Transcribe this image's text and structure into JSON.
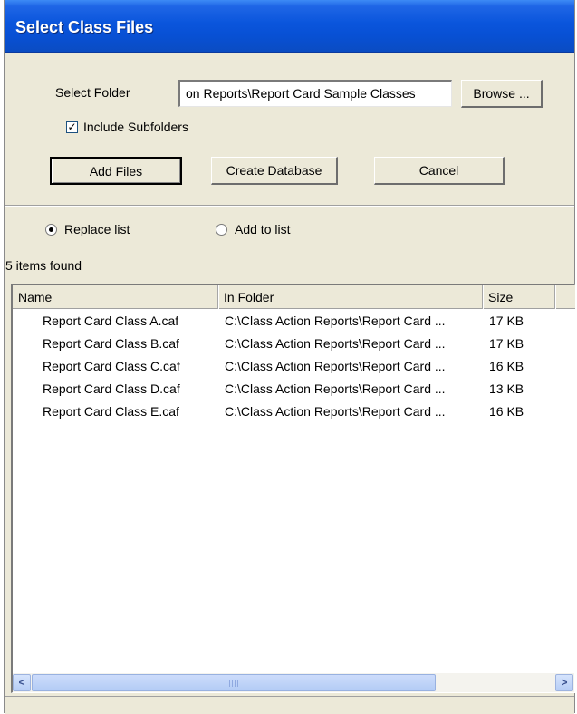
{
  "window": {
    "title": "Select Class Files"
  },
  "form": {
    "folder_label": "Select Folder",
    "folder_value": "on Reports\\Report Card Sample Classes",
    "browse_label": "Browse ...",
    "include_subfolders_label": "Include Subfolders",
    "include_subfolders_checked": true
  },
  "buttons": {
    "add_files": "Add Files",
    "create_database": "Create Database",
    "cancel": "Cancel"
  },
  "mode": {
    "replace_label": "Replace list",
    "add_label": "Add to list",
    "selected": "replace"
  },
  "results": {
    "count_text": "5 items found",
    "columns": [
      "Name",
      "In Folder",
      "Size"
    ],
    "rows": [
      {
        "name": "Report Card Class A.caf",
        "folder": "C:\\Class Action Reports\\Report Card ...",
        "size": "17 KB"
      },
      {
        "name": "Report Card Class B.caf",
        "folder": "C:\\Class Action Reports\\Report Card ...",
        "size": "17 KB"
      },
      {
        "name": "Report Card Class C.caf",
        "folder": "C:\\Class Action Reports\\Report Card ...",
        "size": "16 KB"
      },
      {
        "name": "Report Card Class D.caf",
        "folder": "C:\\Class Action Reports\\Report Card ...",
        "size": "13 KB"
      },
      {
        "name": "Report Card Class E.caf",
        "folder": "C:\\Class Action Reports\\Report Card ...",
        "size": "16 KB"
      }
    ]
  },
  "scrollbar": {
    "left_icon": "scroll-left-arrow-icon",
    "right_icon": "scroll-right-arrow-icon"
  },
  "colors": {
    "title_bar": "#0a55dc",
    "dialog_bg": "#ece9d8",
    "list_bg": "#ffffff"
  }
}
